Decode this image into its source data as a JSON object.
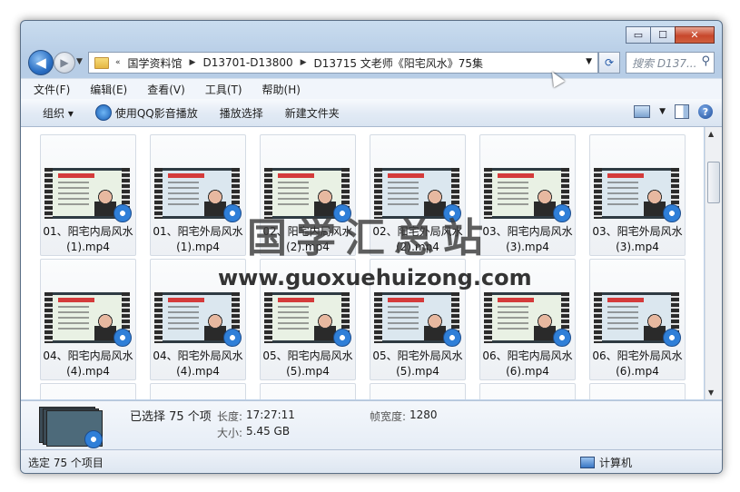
{
  "window": {
    "minimize": "▭",
    "maximize": "☐",
    "close": "✕"
  },
  "address": {
    "prefix": "«",
    "crumbs": [
      "国学资料馆",
      "D13701-D13800",
      "D13715 文老师《阳宅风水》75集"
    ],
    "search_placeholder": "搜索 D137..."
  },
  "menu": [
    "文件(F)",
    "编辑(E)",
    "查看(V)",
    "工具(T)",
    "帮助(H)"
  ],
  "toolbar": {
    "organize": "组织 ▾",
    "play_qq": "使用QQ影音播放",
    "play_select": "播放选择",
    "new_folder": "新建文件夹"
  },
  "files": [
    {
      "name": "01、阳宅内局风水 (1).mp4"
    },
    {
      "name": "01、阳宅外局风水 (1).mp4"
    },
    {
      "name": "02、阳宅内局风水 (2).mp4"
    },
    {
      "name": "02、阳宅外局风水 (2).mp4"
    },
    {
      "name": "03、阳宅内局风水 (3).mp4"
    },
    {
      "name": "03、阳宅外局风水 (3).mp4"
    },
    {
      "name": "04、阳宅内局风水 (4).mp4"
    },
    {
      "name": "04、阳宅外局风水 (4).mp4"
    },
    {
      "name": "05、阳宅内局风水 (5).mp4"
    },
    {
      "name": "05、阳宅外局风水 (5).mp4"
    },
    {
      "name": "06、阳宅内局风水 (6).mp4"
    },
    {
      "name": "06、阳宅外局风水 (6).mp4"
    }
  ],
  "watermark": {
    "text": "国学汇总站",
    "url": "www.guoxuehuizong.com"
  },
  "details": {
    "selected": "已选择 75 个项",
    "length_label": "长度:",
    "length_value": "17:27:11",
    "size_label": "大小:",
    "size_value": "5.45 GB",
    "width_label": "帧宽度:",
    "width_value": "1280"
  },
  "status": {
    "left": "选定 75 个项目",
    "right": "计算机"
  }
}
